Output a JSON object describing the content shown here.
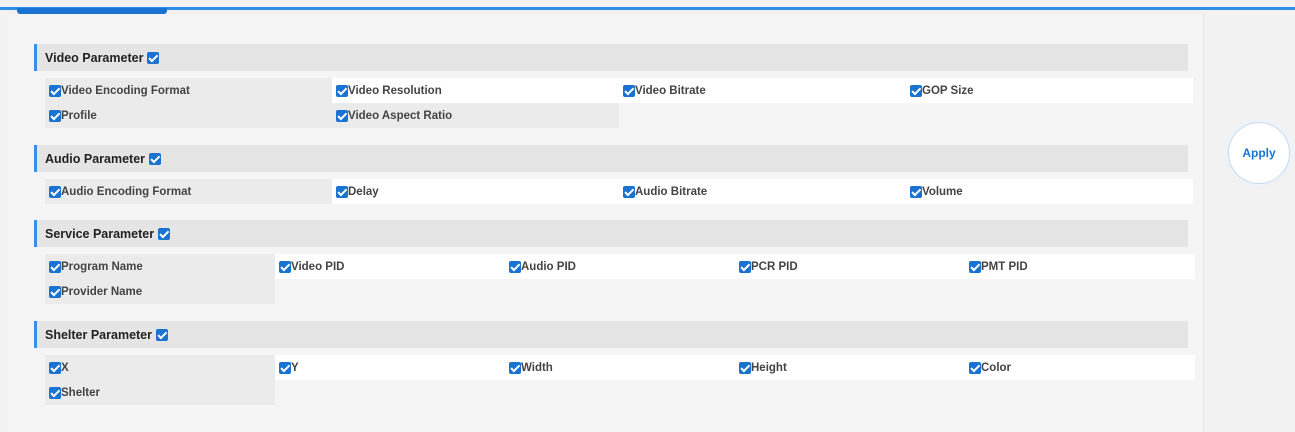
{
  "apply_label": "Apply",
  "accent_color": "#1a73d1",
  "sections": [
    {
      "title": "Video Parameter",
      "checked": true,
      "rows": [
        [
          "Video Encoding Format",
          "Video Resolution",
          "Video Bitrate",
          "GOP Size"
        ],
        [
          "Profile",
          "Video Aspect Ratio"
        ]
      ]
    },
    {
      "title": "Audio Parameter",
      "checked": true,
      "rows": [
        [
          "Audio Encoding Format",
          "Delay",
          "Audio Bitrate",
          "Volume"
        ]
      ]
    },
    {
      "title": "Service Parameter",
      "checked": true,
      "rows": [
        [
          "Program Name",
          "Video PID",
          "Audio PID",
          "PCR PID",
          "PMT PID"
        ],
        [
          "Provider Name"
        ]
      ]
    },
    {
      "title": "Shelter Parameter",
      "checked": true,
      "rows": [
        [
          "X",
          "Y",
          "Width",
          "Height",
          "Color"
        ],
        [
          "Shelter"
        ]
      ]
    }
  ]
}
